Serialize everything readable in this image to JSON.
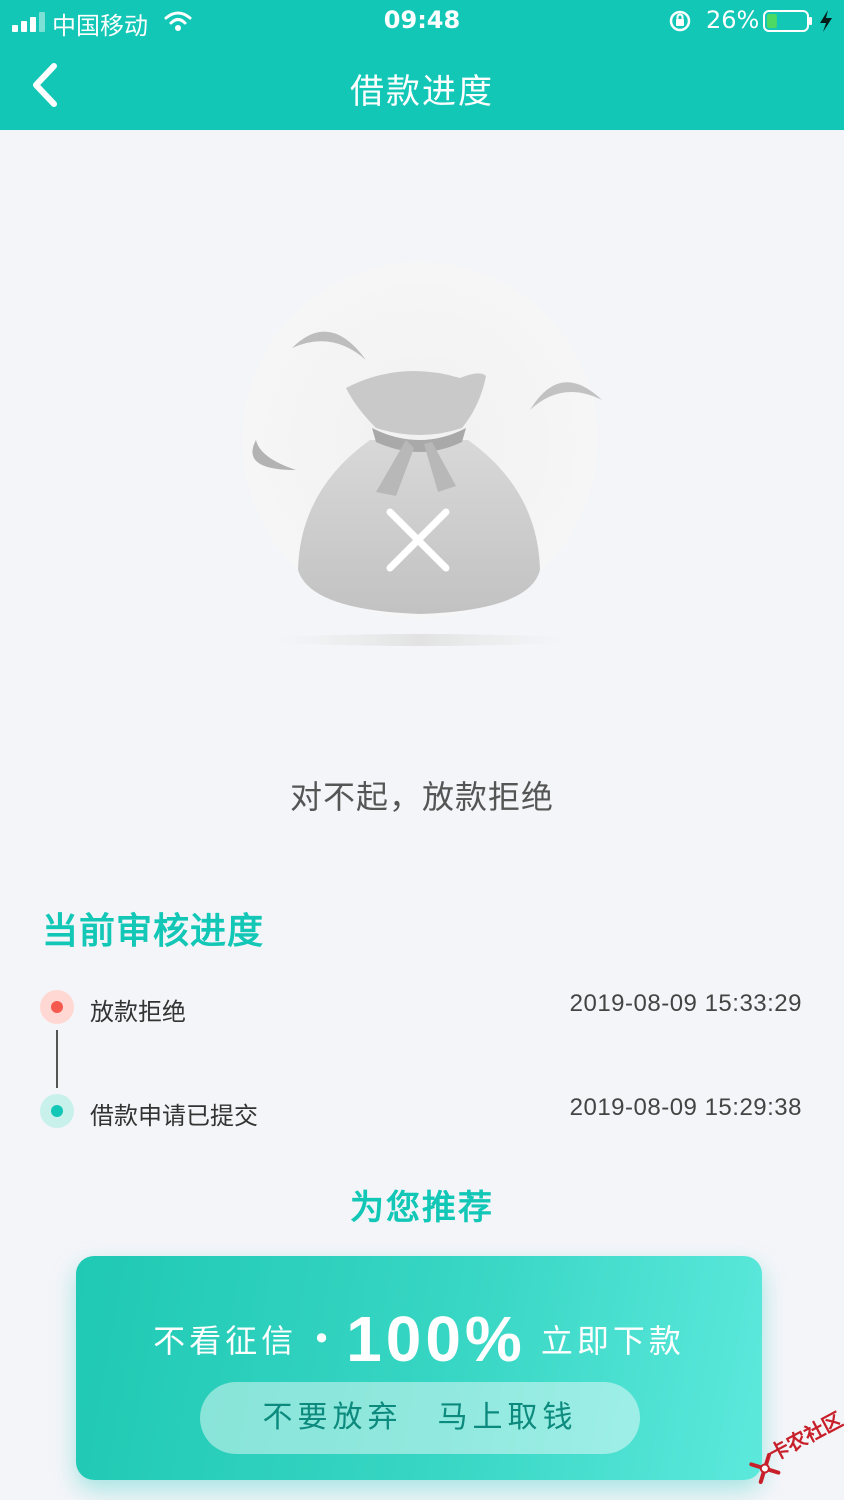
{
  "status_bar": {
    "carrier": "中国移动",
    "time": "09:48",
    "battery_percent": "26%",
    "battery_level": 0.26
  },
  "header": {
    "title": "借款进度",
    "back_icon": "chevron-left-icon"
  },
  "result": {
    "illustration_icon": "money-bag-rejected-icon",
    "message": "对不起，放款拒绝"
  },
  "progress": {
    "section_title": "当前审核进度",
    "steps": [
      {
        "label": "放款拒绝",
        "time": "2019-08-09 15:33:29",
        "status_color": "#f55a4e"
      },
      {
        "label": "借款申请已提交",
        "time": "2019-08-09 15:29:38",
        "status_color": "#13c7b7"
      }
    ]
  },
  "recommend": {
    "title": "为您推荐",
    "promo": {
      "left_text": "不看征信",
      "separator": "•",
      "big_text": "100%",
      "right_text": "立即下款",
      "button_label": "不要放弃　马上取钱"
    }
  },
  "watermark": {
    "text": "卡农社区"
  },
  "colors": {
    "brand": "#13c7b7",
    "background": "#f4f5f9",
    "reject_red": "#f55a4e"
  }
}
